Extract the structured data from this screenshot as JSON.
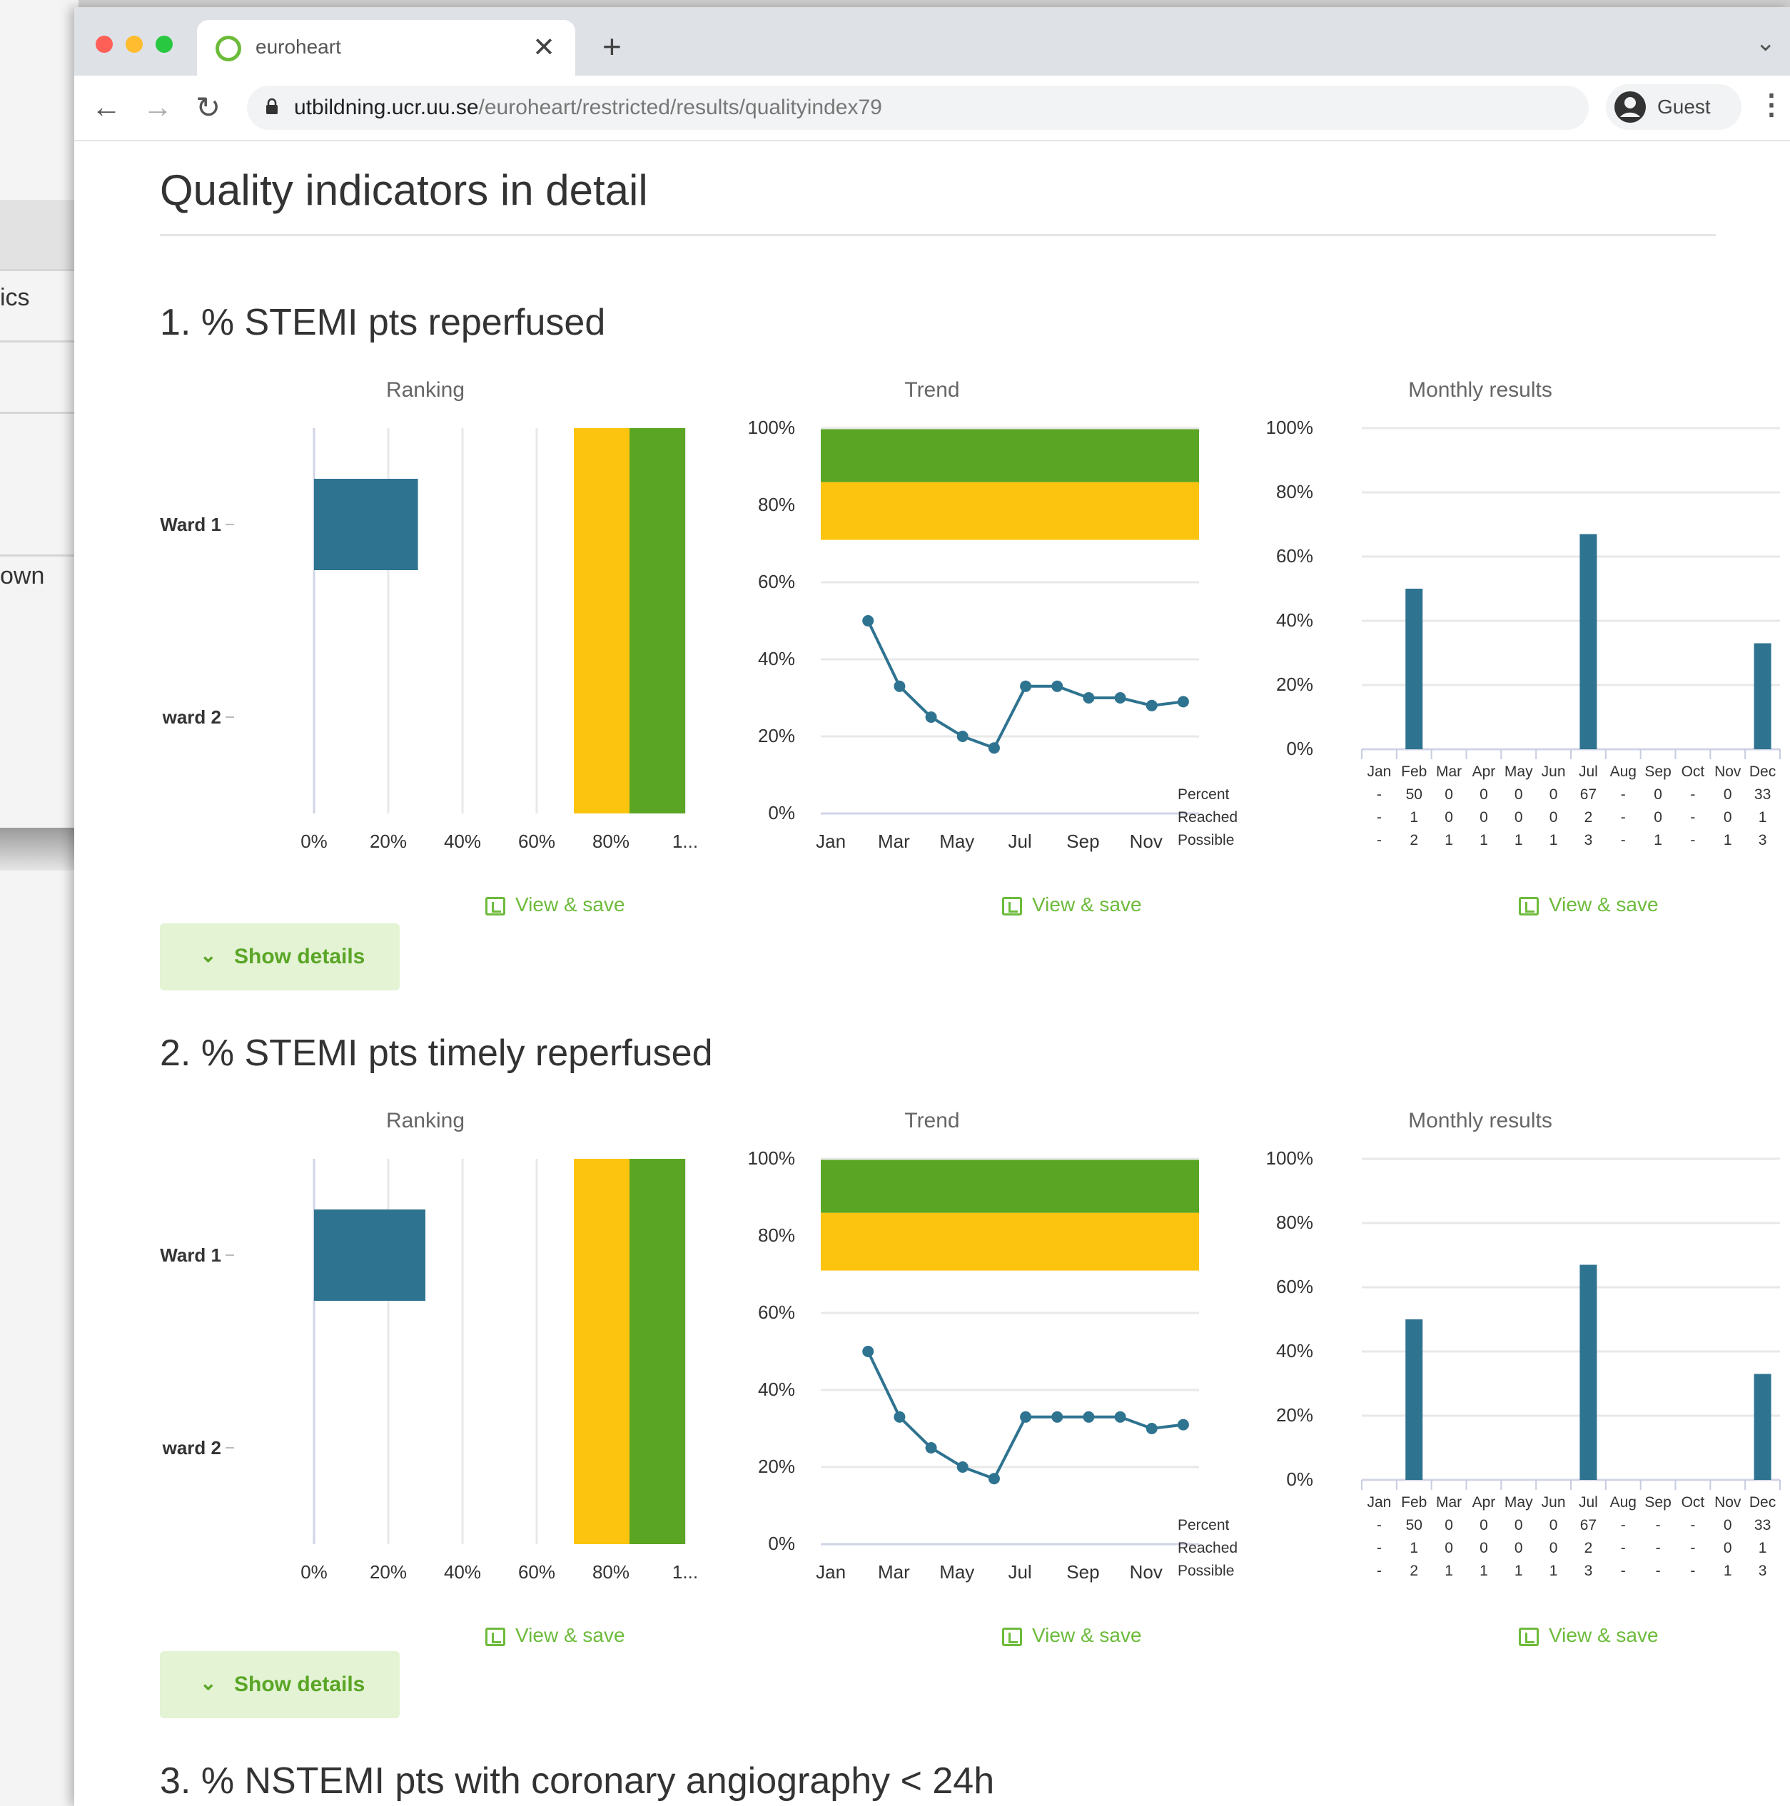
{
  "background_window": {
    "items": [
      "ics",
      "own"
    ]
  },
  "browser": {
    "tab_title": "euroheart",
    "url_host": "utbildning.ucr.uu.se",
    "url_path": "/euroheart/restricted/results/qualityindex79",
    "profile_label": "Guest"
  },
  "page": {
    "title": "Quality indicators in detail",
    "view_save_label": "View & save",
    "show_details_label": "Show details",
    "panel_titles": {
      "ranking": "Ranking",
      "trend": "Trend",
      "monthly": "Monthly results"
    },
    "monthly_row_labels": [
      "Percent",
      "Reached",
      "Possible"
    ]
  },
  "colors": {
    "bar": "#2e7390",
    "target_yellow": "#fcc40e",
    "target_green": "#5aa624",
    "accent_green": "#6dbb3b",
    "grid": "#e8e8e8"
  },
  "sections": [
    {
      "title": "1. % STEMI pts reperfused",
      "chart_data": [
        {
          "type": "bar",
          "title": "Ranking",
          "orientation": "horizontal",
          "categories": [
            "Ward 1",
            "ward 2"
          ],
          "category_labels": [
            "Ward 1",
            "ward 2"
          ],
          "values": [
            28,
            0
          ],
          "x_ticks": [
            "0%",
            "20%",
            "40%",
            "60%",
            "80%",
            "1..."
          ],
          "xlim": [
            0,
            100
          ],
          "target_bands": [
            {
              "from": 70,
              "to": 85,
              "color": "yellow"
            },
            {
              "from": 85,
              "to": 100,
              "color": "green"
            }
          ]
        },
        {
          "type": "line",
          "title": "Trend",
          "x_ticks": [
            "Jan",
            "Mar",
            "May",
            "Jul",
            "Sep",
            "Nov"
          ],
          "y_ticks": [
            "0%",
            "20%",
            "40%",
            "60%",
            "80%",
            "100%"
          ],
          "ylim": [
            0,
            100
          ],
          "x": [
            "Feb",
            "Mar",
            "Apr",
            "May",
            "Jun",
            "Jul",
            "Aug",
            "Sep",
            "Oct",
            "Nov",
            "Dec"
          ],
          "values": [
            50,
            33,
            25,
            20,
            17,
            33,
            33,
            30,
            30,
            28,
            29
          ],
          "target_bands": [
            {
              "from": 71,
              "to": 86,
              "color": "yellow"
            },
            {
              "from": 86,
              "to": 100,
              "color": "green"
            }
          ]
        },
        {
          "type": "bar",
          "title": "Monthly results",
          "categories": [
            "Jan",
            "Feb",
            "Mar",
            "Apr",
            "May",
            "Jun",
            "Jul",
            "Aug",
            "Sep",
            "Oct",
            "Nov",
            "Dec"
          ],
          "values": [
            0,
            50,
            0,
            0,
            0,
            0,
            67,
            0,
            0,
            0,
            0,
            33
          ],
          "y_ticks": [
            "0%",
            "20%",
            "40%",
            "60%",
            "80%",
            "100%"
          ],
          "ylim": [
            0,
            100
          ],
          "table": {
            "Percent": [
              "-",
              "50",
              "0",
              "0",
              "0",
              "0",
              "67",
              "-",
              "0",
              "-",
              "0",
              "33"
            ],
            "Reached": [
              "-",
              "1",
              "0",
              "0",
              "0",
              "0",
              "2",
              "-",
              "0",
              "-",
              "0",
              "1"
            ],
            "Possible": [
              "-",
              "2",
              "1",
              "1",
              "1",
              "1",
              "3",
              "-",
              "1",
              "-",
              "1",
              "3"
            ]
          }
        }
      ]
    },
    {
      "title": "2. % STEMI pts timely reperfused",
      "chart_data": [
        {
          "type": "bar",
          "title": "Ranking",
          "orientation": "horizontal",
          "categories": [
            "Ward 1",
            "ward 2"
          ],
          "category_labels": [
            "Ward 1",
            "ward 2"
          ],
          "values": [
            30,
            0
          ],
          "x_ticks": [
            "0%",
            "20%",
            "40%",
            "60%",
            "80%",
            "1..."
          ],
          "xlim": [
            0,
            100
          ],
          "target_bands": [
            {
              "from": 70,
              "to": 85,
              "color": "yellow"
            },
            {
              "from": 85,
              "to": 100,
              "color": "green"
            }
          ]
        },
        {
          "type": "line",
          "title": "Trend",
          "x_ticks": [
            "Jan",
            "Mar",
            "May",
            "Jul",
            "Sep",
            "Nov"
          ],
          "y_ticks": [
            "0%",
            "20%",
            "40%",
            "60%",
            "80%",
            "100%"
          ],
          "ylim": [
            0,
            100
          ],
          "x": [
            "Feb",
            "Mar",
            "Apr",
            "May",
            "Jun",
            "Jul",
            "Aug",
            "Sep",
            "Oct",
            "Nov",
            "Dec"
          ],
          "values": [
            50,
            33,
            25,
            20,
            17,
            33,
            33,
            33,
            33,
            30,
            31
          ],
          "target_bands": [
            {
              "from": 71,
              "to": 86,
              "color": "yellow"
            },
            {
              "from": 86,
              "to": 100,
              "color": "green"
            }
          ]
        },
        {
          "type": "bar",
          "title": "Monthly results",
          "categories": [
            "Jan",
            "Feb",
            "Mar",
            "Apr",
            "May",
            "Jun",
            "Jul",
            "Aug",
            "Sep",
            "Oct",
            "Nov",
            "Dec"
          ],
          "values": [
            0,
            50,
            0,
            0,
            0,
            0,
            67,
            0,
            0,
            0,
            0,
            33
          ],
          "y_ticks": [
            "0%",
            "20%",
            "40%",
            "60%",
            "80%",
            "100%"
          ],
          "ylim": [
            0,
            100
          ],
          "table": {
            "Percent": [
              "-",
              "50",
              "0",
              "0",
              "0",
              "0",
              "67",
              "-",
              "-",
              "-",
              "0",
              "33"
            ],
            "Reached": [
              "-",
              "1",
              "0",
              "0",
              "0",
              "0",
              "2",
              "-",
              "-",
              "-",
              "0",
              "1"
            ],
            "Possible": [
              "-",
              "2",
              "1",
              "1",
              "1",
              "1",
              "3",
              "-",
              "-",
              "-",
              "1",
              "3"
            ]
          }
        }
      ]
    },
    {
      "title": "3. % NSTEMI pts with coronary angiography < 24h"
    }
  ]
}
